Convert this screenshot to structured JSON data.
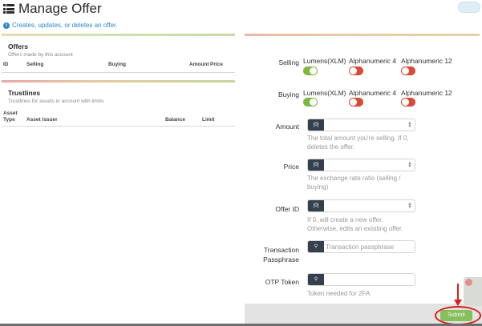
{
  "header": {
    "title": "Manage Offer",
    "icon": "list-icon"
  },
  "info": {
    "text": "Creates, updates, or deletes an offer.",
    "icon": "info-icon"
  },
  "offers": {
    "title": "Offers",
    "subtitle": "Offers made by this account",
    "columns": [
      "ID",
      "Selling",
      "Buying",
      "Amount",
      "Price"
    ]
  },
  "trustlines": {
    "title": "Trustlines",
    "subtitle": "Trustlines for assets in account with limits",
    "columns": [
      "Asset Type",
      "Asset Issuer",
      "Balance",
      "Limit"
    ]
  },
  "form": {
    "selling": {
      "label": "Selling",
      "options": [
        {
          "label": "Lumens(XLM)",
          "on": true
        },
        {
          "label": "Alphanumeric 4",
          "on": false
        },
        {
          "label": "Alphanumeric 12",
          "on": false
        }
      ]
    },
    "buying": {
      "label": "Buying",
      "options": [
        {
          "label": "Lumens(XLM)",
          "on": true
        },
        {
          "label": "Alphanumeric 4",
          "on": false
        },
        {
          "label": "Alphanumeric 12",
          "on": false
        }
      ]
    },
    "amount": {
      "label": "Amount",
      "help": "The total amount you're selling. If 0, deletes the offer."
    },
    "price": {
      "label": "Price",
      "help": "The exchange rate ratio (selling / buying)"
    },
    "offer_id": {
      "label": "Offer ID",
      "help": "If 0, will create a new offer. Otherwise, edits an exisiting offer."
    },
    "passphrase": {
      "label": "Transaction Passphrase",
      "placeholder": "Transaction passphrase"
    },
    "otp": {
      "label": "OTP Token",
      "help": "Token needed for 2FA"
    },
    "addon_numeric": "[0]",
    "addon_key": "key-icon"
  },
  "submit": {
    "label": "Submit"
  },
  "colors": {
    "accent": "#2b88c9",
    "toggle_on": "#7cba3d",
    "toggle_off": "#d84a3a",
    "addon": "#34404e",
    "submit": "#87c05b",
    "annotation": "#d81e1e"
  }
}
